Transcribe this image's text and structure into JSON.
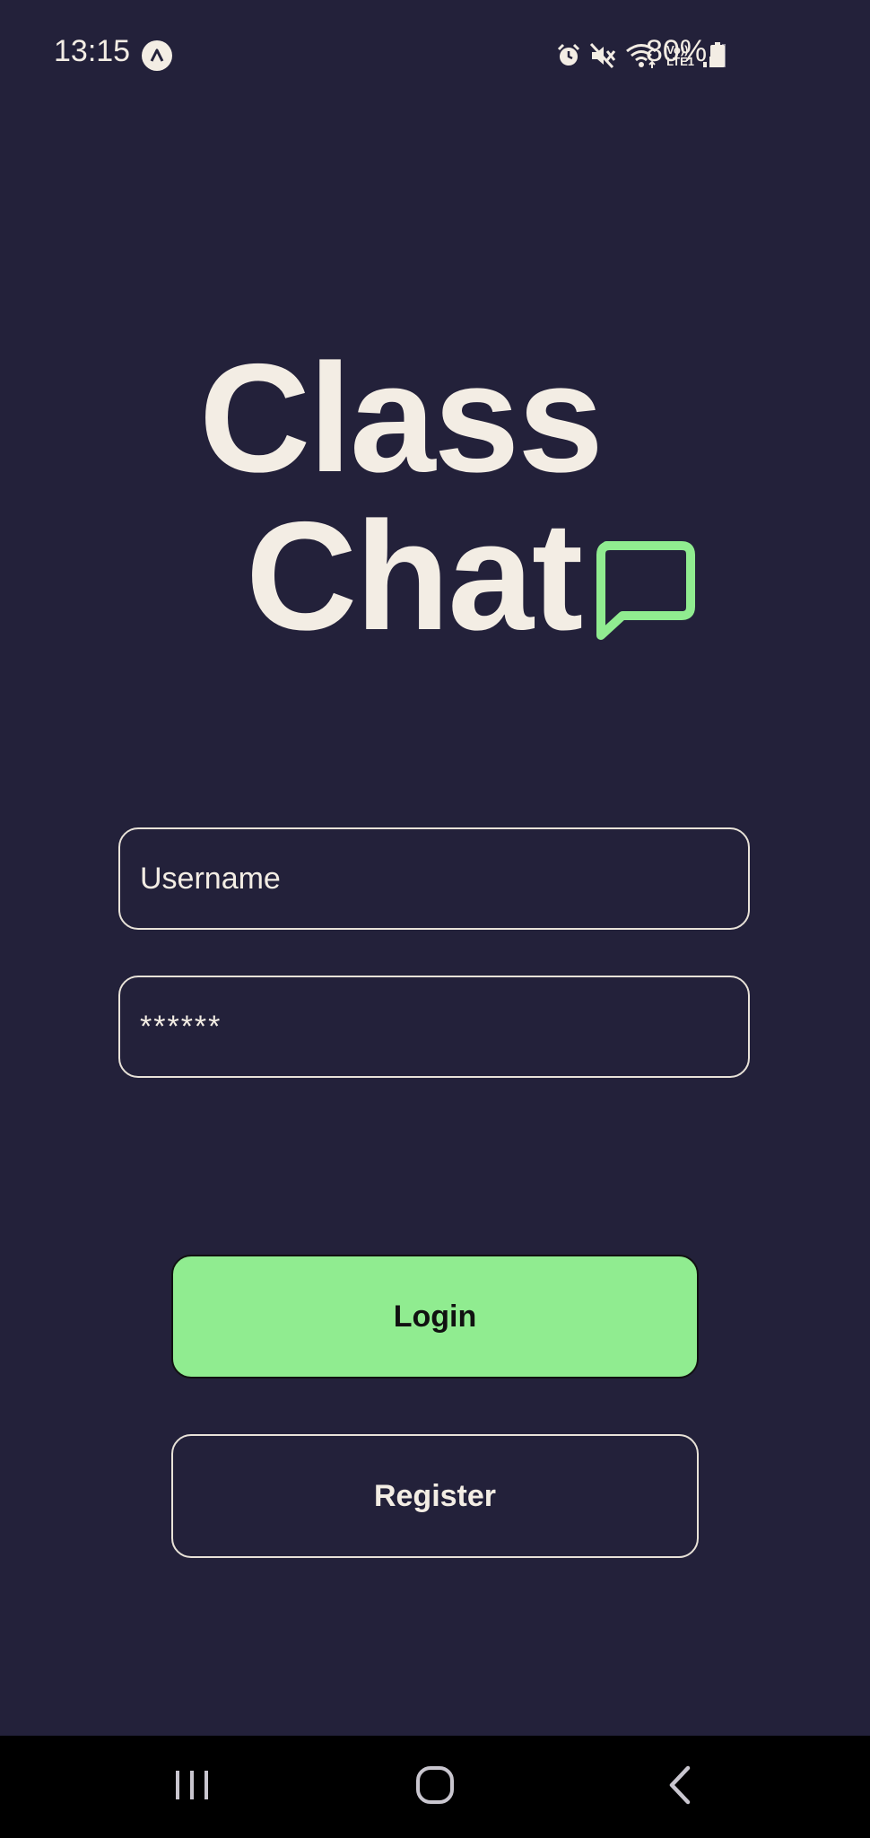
{
  "status_bar": {
    "time": "13:15",
    "battery": "80%",
    "network_label_top": "Vo))",
    "network_label_bottom": "LTE1"
  },
  "logo": {
    "line1": "Class",
    "line2": "Chat",
    "accent_color": "#90ec90"
  },
  "form": {
    "username_placeholder": "Username",
    "username_value": "",
    "password_value": "******"
  },
  "buttons": {
    "login_label": "Login",
    "register_label": "Register"
  },
  "colors": {
    "background": "#23213a",
    "text": "#f3ede4",
    "login_button": "#90ec90"
  },
  "icons": {
    "status": [
      "app-notification-icon",
      "alarm-icon",
      "mute-icon",
      "wifi-icon",
      "signal-icon",
      "battery-icon"
    ],
    "nav": [
      "recents-icon",
      "home-icon",
      "back-icon"
    ]
  }
}
